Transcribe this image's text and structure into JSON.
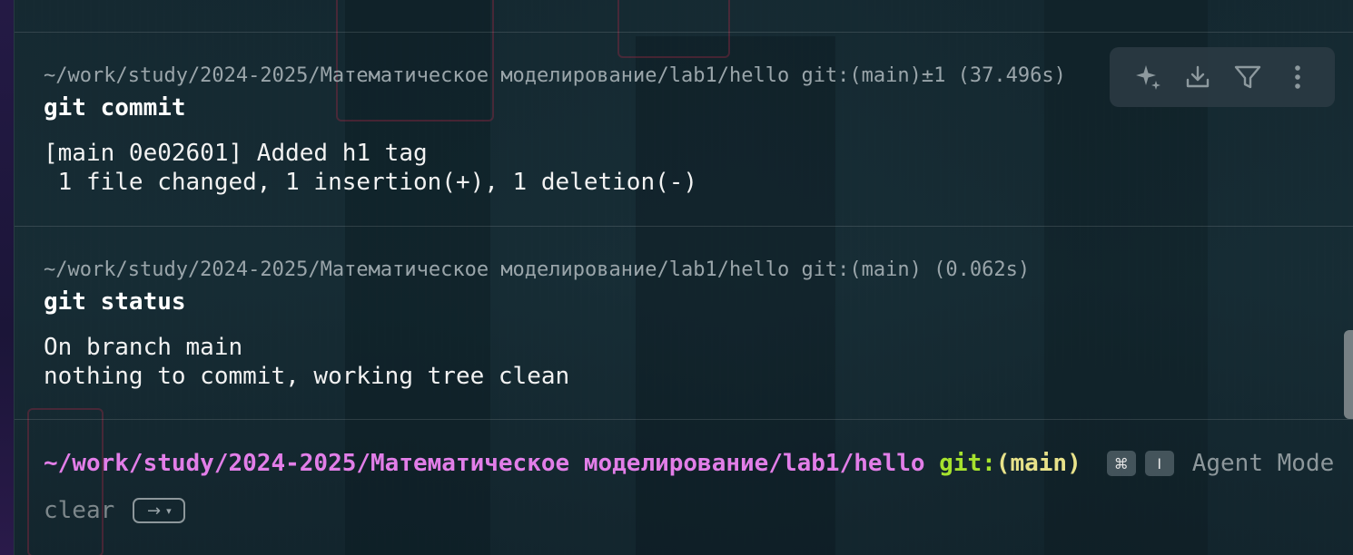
{
  "blocks": [
    {
      "prompt": "~/work/study/2024-2025/Математическое моделирование/lab1/hello git:(main)±1 (37.496s)",
      "command": "git commit",
      "output": [
        "[main 0e02601] Added h1 tag",
        " 1 file changed, 1 insertion(+), 1 deletion(-)"
      ]
    },
    {
      "prompt": "~/work/study/2024-2025/Математическое моделирование/lab1/hello git:(main) (0.062s)",
      "command": "git status",
      "output": [
        "On branch main",
        "nothing to commit, working tree clean"
      ]
    }
  ],
  "toolbar": {
    "icons": [
      "sparkle-icon",
      "download-icon",
      "filter-icon",
      "more-vertical-icon"
    ]
  },
  "input": {
    "path": "~/work/study/2024-2025/Математическое моделирование/lab1/hello",
    "git_label": "git:",
    "branch": "(main)",
    "shortcut_cmd": "⌘",
    "shortcut_key": "I",
    "agent_mode": "Agent Mode",
    "suggestion": "clear",
    "suggest_arrow": "→",
    "suggest_caret": "▾"
  },
  "colors": {
    "path_pink": "#e27ee8",
    "git_green": "#a6e22e",
    "branch_yellow": "#e8e28a"
  }
}
